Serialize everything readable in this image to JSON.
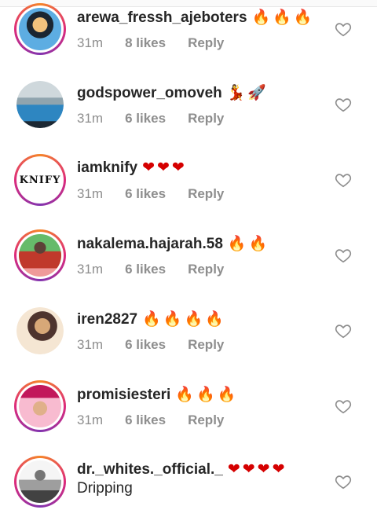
{
  "comments": [
    {
      "username": "arewa_fressh_ajeboters",
      "emoji": "🔥🔥🔥",
      "emoji_kind": "fire",
      "time": "31m",
      "likes": "8 likes",
      "reply": "Reply",
      "avatar_icon": "person-with-sunglasses-avatar",
      "avatar_colors": [
        "#2c3e50",
        "#5dade2"
      ]
    },
    {
      "username": "godspower_omoveh",
      "emoji": "💃🚀",
      "emoji_kind": "other",
      "time": "31m",
      "likes": "6 likes",
      "reply": "Reply",
      "avatar_icon": "person-in-blue-avatar",
      "avatar_colors": [
        "#b0bec5",
        "#2e86c1"
      ]
    },
    {
      "username": "iamknify",
      "emoji": "❤❤❤",
      "emoji_kind": "heart",
      "time": "31m",
      "likes": "6 likes",
      "reply": "Reply",
      "avatar_icon": "knify-logo-avatar",
      "avatar_text": "KNIFY",
      "avatar_colors": [
        "#ffffff",
        "#111111"
      ]
    },
    {
      "username": "nakalema.hajarah.58",
      "emoji": "🔥🔥",
      "emoji_kind": "fire",
      "time": "31m",
      "likes": "6 likes",
      "reply": "Reply",
      "avatar_icon": "woman-in-red-avatar",
      "avatar_colors": [
        "#c0392b",
        "#27ae60"
      ]
    },
    {
      "username": "iren2827",
      "emoji": "🔥🔥🔥🔥",
      "emoji_kind": "fire",
      "time": "31m",
      "likes": "6 likes",
      "reply": "Reply",
      "avatar_icon": "woman-portrait-avatar",
      "avatar_colors": [
        "#f5e6d3",
        "#6d4c41"
      ]
    },
    {
      "username": "promisiesteri",
      "emoji": "🔥🔥🔥",
      "emoji_kind": "fire",
      "time": "31m",
      "likes": "6 likes",
      "reply": "Reply",
      "avatar_icon": "woman-headwrap-avatar",
      "avatar_colors": [
        "#f8bbd0",
        "#c2185b"
      ]
    },
    {
      "username": "dr._whites._official._",
      "emoji": "❤❤❤❤",
      "emoji_kind": "heart",
      "text": "Dripping",
      "avatar_icon": "man-grayscale-avatar",
      "avatar_colors": [
        "#e0e0e0",
        "#424242"
      ]
    }
  ],
  "icons": {
    "like": "heart-outline-icon"
  }
}
